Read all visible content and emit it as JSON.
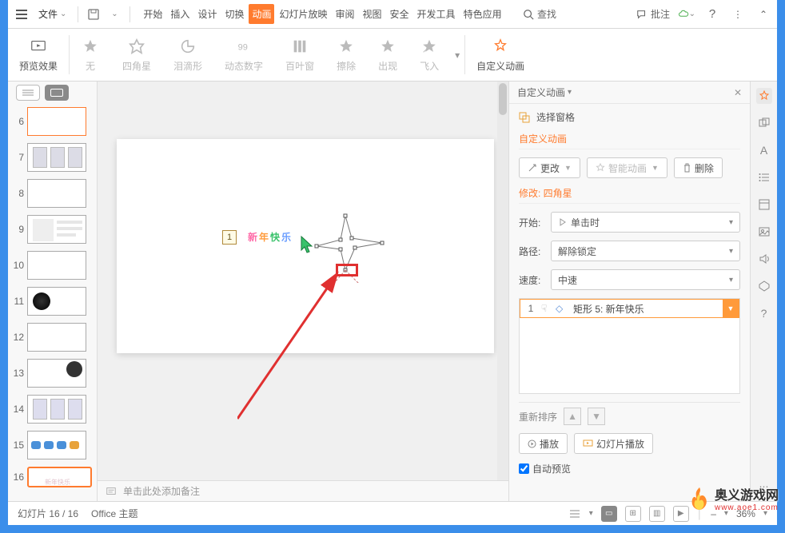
{
  "menu": {
    "file": "文件",
    "tabs": [
      "开始",
      "插入",
      "设计",
      "切换",
      "动画",
      "幻灯片放映",
      "审阅",
      "视图",
      "安全",
      "开发工具",
      "特色应用"
    ],
    "active": 4,
    "search": "查找",
    "annotate": "批注"
  },
  "ribbon": {
    "preview": "预览效果",
    "items": [
      "无",
      "四角星",
      "泪滴形",
      "动态数字",
      "百叶窗",
      "擦除",
      "出现",
      "飞入"
    ],
    "custom": "自定义动画"
  },
  "thumbs": {
    "start": 6,
    "count": 11,
    "selected": 16,
    "highlight": 6
  },
  "canvas": {
    "index": "1",
    "text": "新年快乐",
    "notes_placeholder": "单击此处添加备注"
  },
  "panel": {
    "title": "自定义动画",
    "select_pane": "选择窗格",
    "section": "自定义动画",
    "btn_change": "更改",
    "btn_smart": "智能动画",
    "btn_delete": "删除",
    "modify": "修改: 四角星",
    "f_start": "开始:",
    "v_start": "单击时",
    "f_path": "路径:",
    "v_path": "解除锁定",
    "f_speed": "速度:",
    "v_speed": "中速",
    "ani_num": "1",
    "ani_name": "矩形 5: 新年快乐",
    "reorder": "重新排序",
    "play": "播放",
    "slideshow": "幻灯片播放",
    "autopreview": "自动预览"
  },
  "status": {
    "slides": "幻灯片 16 / 16",
    "theme": "Office 主题",
    "zoom": "36%"
  },
  "watermark": {
    "name": "奥义游戏网",
    "url": "www.aoe1.com"
  }
}
